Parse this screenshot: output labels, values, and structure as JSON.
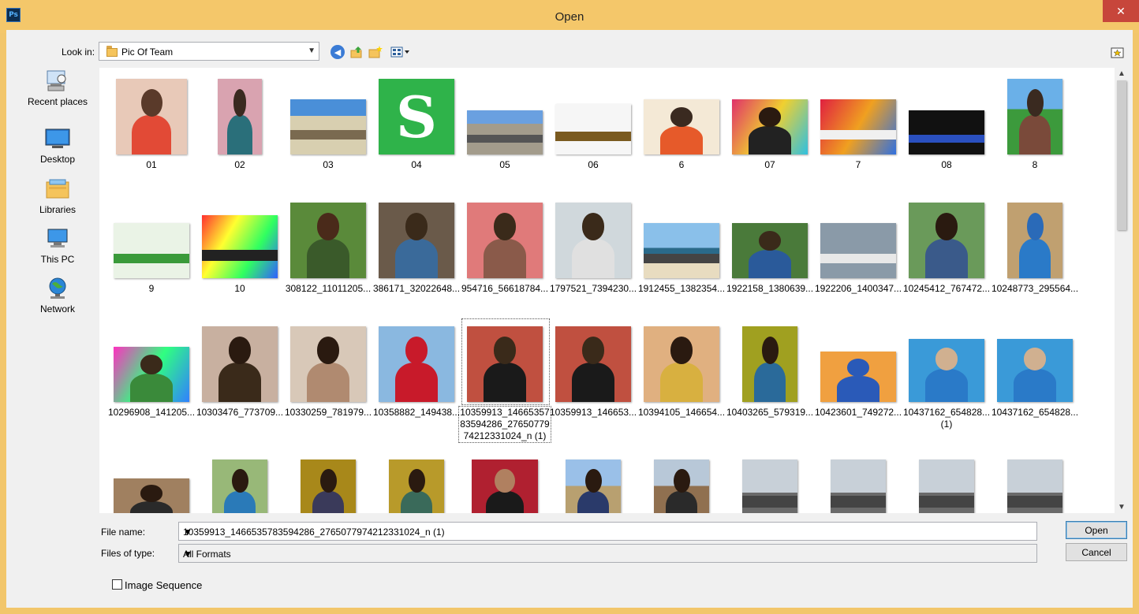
{
  "window": {
    "title": "Open",
    "app_icon": "Ps",
    "close_glyph": "✕"
  },
  "toolbar": {
    "look_in_label": "Look in:",
    "look_in_value": "Pic Of Team",
    "icons": [
      "back-icon",
      "up-folder-icon",
      "new-folder-icon",
      "view-menu-icon"
    ]
  },
  "places": [
    {
      "label": "Recent places",
      "icon": "recent-places-icon"
    },
    {
      "label": "Desktop",
      "icon": "desktop-icon"
    },
    {
      "label": "Libraries",
      "icon": "libraries-icon"
    },
    {
      "label": "This PC",
      "icon": "this-pc-icon"
    },
    {
      "label": "Network",
      "icon": "network-icon"
    }
  ],
  "files": [
    {
      "name": "01"
    },
    {
      "name": "02"
    },
    {
      "name": "03"
    },
    {
      "name": "04"
    },
    {
      "name": "05"
    },
    {
      "name": "06"
    },
    {
      "name": "6"
    },
    {
      "name": "07"
    },
    {
      "name": "7"
    },
    {
      "name": "08"
    },
    {
      "name": "8"
    },
    {
      "name": "9"
    },
    {
      "name": "10"
    },
    {
      "name": "308122_11011205..."
    },
    {
      "name": "386171_32022648..."
    },
    {
      "name": "954716_56618784..."
    },
    {
      "name": "1797521_7394230..."
    },
    {
      "name": "1912455_1382354..."
    },
    {
      "name": "1922158_1380639..."
    },
    {
      "name": "1922206_1400347..."
    },
    {
      "name": "10245412_767472..."
    },
    {
      "name": "10248773_295564..."
    },
    {
      "name": "10296908_141205..."
    },
    {
      "name": "10303476_773709..."
    },
    {
      "name": "10330259_781979..."
    },
    {
      "name": "10358882_149438..."
    },
    {
      "name": "10359913_1466535783594286_2765077974212331024_n (1)",
      "selected": true
    },
    {
      "name": "10359913_146653..."
    },
    {
      "name": "10394105_146654..."
    },
    {
      "name": "10403265_579319..."
    },
    {
      "name": "10423601_749272..."
    },
    {
      "name": "10437162_654828... (1)"
    },
    {
      "name": "10437162_654828..."
    },
    {
      "name": ""
    },
    {
      "name": ""
    },
    {
      "name": ""
    },
    {
      "name": ""
    },
    {
      "name": ""
    },
    {
      "name": ""
    },
    {
      "name": ""
    },
    {
      "name": ""
    },
    {
      "name": ""
    },
    {
      "name": ""
    },
    {
      "name": ""
    }
  ],
  "file_name": {
    "label": "File name:",
    "value": "10359913_1466535783594286_2765077974212331024_n (1)"
  },
  "file_type": {
    "label": "Files of type:",
    "value": "All Formats"
  },
  "buttons": {
    "open": "Open",
    "cancel": "Cancel"
  },
  "image_sequence": {
    "label": "Image Sequence",
    "checked": false
  },
  "colors": {
    "accent": "#f4c76a",
    "close": "#c7463b",
    "selection_border": "#3c7fb1"
  }
}
